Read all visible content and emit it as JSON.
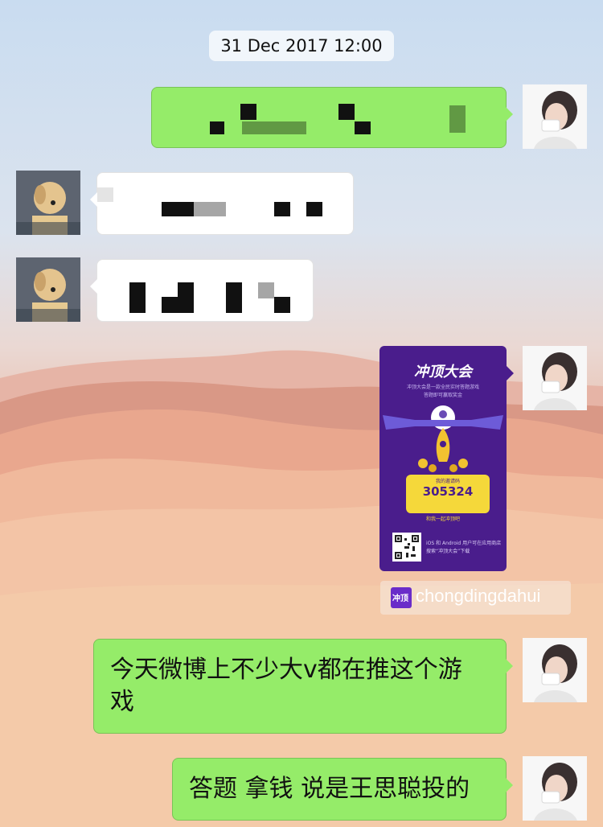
{
  "timestamp": "31 Dec 2017 12:00",
  "messages": [
    {
      "from": "me",
      "content": "[blurred text]"
    },
    {
      "from": "contact",
      "content": "[blurred text]"
    },
    {
      "from": "contact",
      "content": "[blurred text]"
    },
    {
      "from": "me",
      "type": "image-card"
    },
    {
      "from": "me",
      "text": "今天微博上不少大v都在推这个游戏"
    },
    {
      "from": "me",
      "text": "答题 拿钱 说是王思聪投的"
    }
  ],
  "card": {
    "title": "冲顶大会",
    "subtitle_line1": "冲顶大会是一款全民实时答题游戏",
    "subtitle_line2": "答题即可赢取奖金",
    "code_label": "我的邀请码",
    "code": "305324",
    "code_hint": "和我一起冲顶吧",
    "footer_line1": "iOS 和 Android 用户可在应用商店",
    "footer_line2": "搜索“冲顶大会”下载"
  },
  "link_chip": {
    "icon_label": "冲顶",
    "text": "chongdingdahui"
  },
  "text_message_1": {
    "line1": "今天微博上不少大v都在推这个游",
    "line2": "戏"
  },
  "text_message_2": "答题 拿钱 说是王思聪投的",
  "colors": {
    "green_bubble": "#95ec69",
    "card_purple": "#4a1d8c",
    "ticket_yellow": "#f5d83a"
  }
}
